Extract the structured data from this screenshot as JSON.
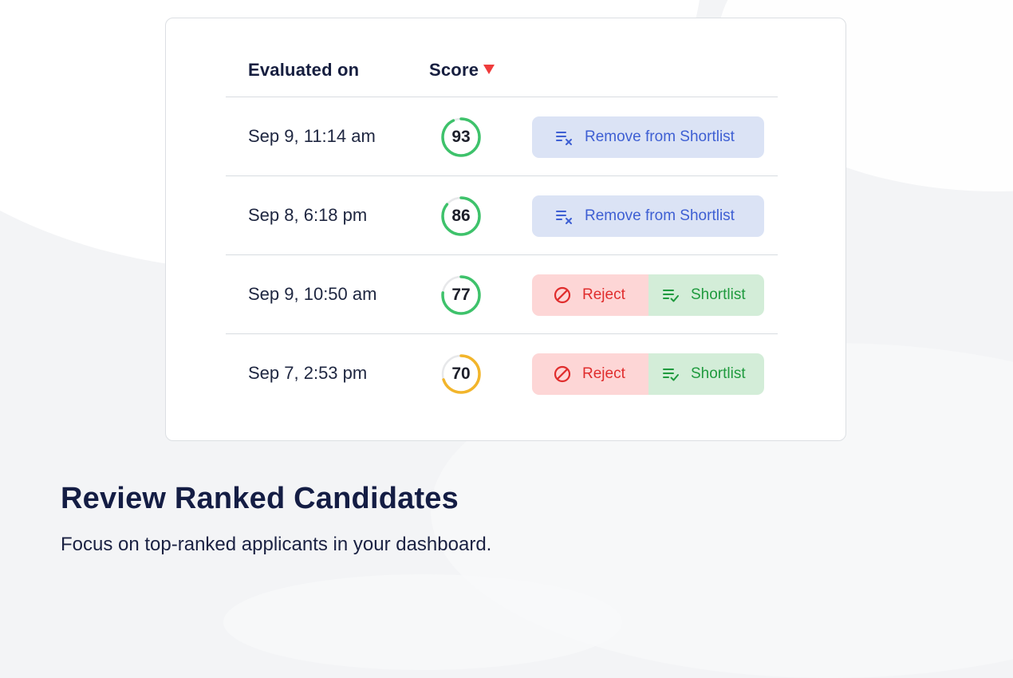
{
  "table": {
    "headers": {
      "date": "Evaluated on",
      "score": "Score"
    },
    "rows": [
      {
        "date": "Sep 9, 11:14 am",
        "score": 93,
        "ring_color": "#3ec26b",
        "status": "shortlisted"
      },
      {
        "date": "Sep 8, 6:18 pm",
        "score": 86,
        "ring_color": "#3ec26b",
        "status": "shortlisted"
      },
      {
        "date": "Sep 9, 10:50 am",
        "score": 77,
        "ring_color": "#3ec26b",
        "status": "pending"
      },
      {
        "date": "Sep 7, 2:53 pm",
        "score": 70,
        "ring_color": "#f2b52b",
        "status": "pending"
      }
    ]
  },
  "actions": {
    "remove_label": "Remove from Shortlist",
    "reject_label": "Reject",
    "shortlist_label": "Shortlist"
  },
  "footer": {
    "title": "Review Ranked Candidates",
    "subtitle": "Focus on top-ranked applicants in your dashboard."
  },
  "colors": {
    "sort_arrow": "#ef3b3b",
    "ring_track": "#e7e8ea",
    "remove_bg": "#dbe3f5",
    "remove_fg": "#3e5fd3",
    "reject_bg": "#fdd6d6",
    "reject_fg": "#e02d2d",
    "shortlist_bg": "#d3edd8",
    "shortlist_fg": "#1f9a3e"
  },
  "icons": {
    "sort": "sort-desc-icon",
    "remove": "list-remove-icon",
    "reject": "ban-icon",
    "shortlist": "list-check-icon"
  }
}
